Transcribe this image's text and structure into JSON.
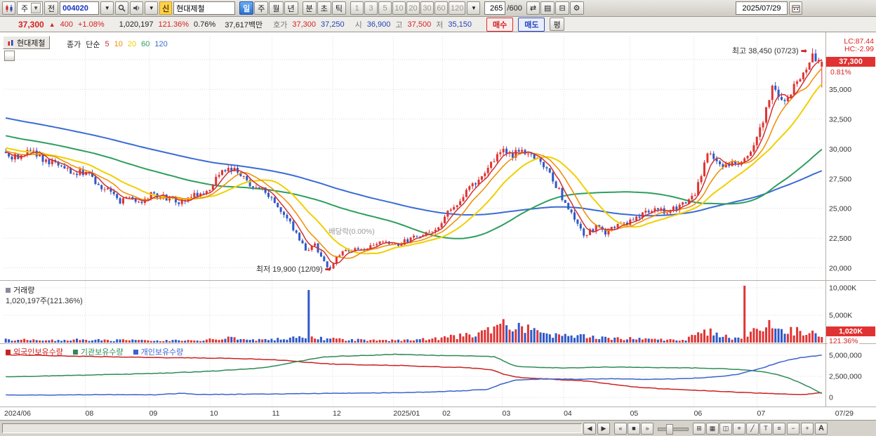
{
  "toolbar": {
    "period_select": "주",
    "prev_button": "전",
    "code_input": "004020",
    "new_badge": "신",
    "stock_name": "현대제철",
    "period_buttons": [
      "일",
      "주",
      "월",
      "년"
    ],
    "active_period": "일",
    "intraday_buttons": [
      "분",
      "초",
      "틱"
    ],
    "tick_presets": [
      "1",
      "3",
      "5",
      "10",
      "20",
      "30",
      "60",
      "120"
    ],
    "candle_count": "265",
    "candle_total": "/600",
    "date": "2025/07/29",
    "icon_glyphs": {
      "dropdown": "▼",
      "pan": "⇄",
      "layout": "▤",
      "save": "⊟",
      "gear": "⚙"
    }
  },
  "infobar": {
    "price": "37,300",
    "change_arrow": "▲",
    "change": "400",
    "change_pct": "+1.08%",
    "volume": "1,020,197",
    "volume_ratio": "121.36%",
    "strength": "0.76%",
    "value": "37,617백만",
    "hoga_label": "호가",
    "ask": "37,300",
    "bid": "37,250",
    "open_label": "시",
    "open": "36,900",
    "high_label": "고",
    "high": "37,500",
    "low_label": "저",
    "low": "35,150",
    "buy_button": "매수",
    "sell_button": "매도",
    "avg_button": "평"
  },
  "chart": {
    "tab_label": "현대제철",
    "legend_price_type": "종가",
    "legend_ma_type": "단순",
    "lc": "LC:87.44",
    "hc": "HC:-2.99",
    "price_tag": "37,300",
    "price_tag_pct": "0.81%",
    "annotation_high": "최고 38,450 (07/23)",
    "annotation_low": "최저 19,900 (12/09)",
    "annotation_exdiv": "배당락(0.00%)",
    "arrow_glyph": "➡",
    "volume_label": "거래량",
    "volume_value": "1,020,197주(121.36%)",
    "volume_tag": "1,020K",
    "volume_tag_pct": "121.36%"
  },
  "chart_data": {
    "type": "candlestick",
    "title": "현대제철(004020) 일봉 2024/06 ~ 2025/07/29",
    "visible_candles": 265,
    "colors": {
      "up": "#e03434",
      "down": "#3059c8"
    },
    "price_axis": {
      "ylim": [
        19500,
        39000
      ],
      "hidden_gridline": 37500,
      "ticks": [
        {
          "v": 35000,
          "label": "35,000"
        },
        {
          "v": 32500,
          "label": "32,500"
        },
        {
          "v": 30000,
          "label": "30,000"
        },
        {
          "v": 27500,
          "label": "27,500"
        },
        {
          "v": 25000,
          "label": "25,000"
        },
        {
          "v": 22500,
          "label": "22,500"
        },
        {
          "v": 20000,
          "label": "20,000"
        }
      ]
    },
    "x_labels": [
      {
        "label": "2024/06",
        "f": 0
      },
      {
        "label": "08",
        "f": 0.099
      },
      {
        "label": "09",
        "f": 0.177
      },
      {
        "label": "10",
        "f": 0.251
      },
      {
        "label": "11",
        "f": 0.327
      },
      {
        "label": "12",
        "f": 0.401
      },
      {
        "label": "2025/01",
        "f": 0.475
      },
      {
        "label": "02",
        "f": 0.535
      },
      {
        "label": "03",
        "f": 0.608
      },
      {
        "label": "04",
        "f": 0.683
      },
      {
        "label": "05",
        "f": 0.764
      },
      {
        "label": "06",
        "f": 0.842
      },
      {
        "label": "07",
        "f": 0.919
      }
    ],
    "x_last_label": "07/29",
    "close_keyframes": [
      [
        0,
        29600
      ],
      [
        0.012,
        29200
      ],
      [
        0.03,
        29750
      ],
      [
        0.048,
        29100
      ],
      [
        0.065,
        28600
      ],
      [
        0.08,
        28150
      ],
      [
        0.099,
        27900
      ],
      [
        0.11,
        27100
      ],
      [
        0.125,
        26400
      ],
      [
        0.14,
        25600
      ],
      [
        0.152,
        26000
      ],
      [
        0.165,
        25300
      ],
      [
        0.18,
        26300
      ],
      [
        0.195,
        25800
      ],
      [
        0.212,
        25600
      ],
      [
        0.228,
        26100
      ],
      [
        0.245,
        26500
      ],
      [
        0.258,
        27400
      ],
      [
        0.27,
        28300
      ],
      [
        0.285,
        28000
      ],
      [
        0.3,
        27100
      ],
      [
        0.315,
        26600
      ],
      [
        0.33,
        25500
      ],
      [
        0.345,
        24200
      ],
      [
        0.358,
        22700
      ],
      [
        0.368,
        21500
      ],
      [
        0.378,
        21900
      ],
      [
        0.388,
        20700
      ],
      [
        0.398,
        19950
      ],
      [
        0.408,
        21100
      ],
      [
        0.42,
        21600
      ],
      [
        0.435,
        21300
      ],
      [
        0.45,
        21800
      ],
      [
        0.465,
        22200
      ],
      [
        0.48,
        22000
      ],
      [
        0.495,
        22400
      ],
      [
        0.51,
        22800
      ],
      [
        0.525,
        23200
      ],
      [
        0.54,
        24400
      ],
      [
        0.555,
        25600
      ],
      [
        0.57,
        26700
      ],
      [
        0.585,
        27800
      ],
      [
        0.598,
        29200
      ],
      [
        0.61,
        30000
      ],
      [
        0.62,
        29500
      ],
      [
        0.632,
        30100
      ],
      [
        0.642,
        29400
      ],
      [
        0.655,
        28900
      ],
      [
        0.668,
        27600
      ],
      [
        0.68,
        26200
      ],
      [
        0.69,
        24800
      ],
      [
        0.7,
        23600
      ],
      [
        0.71,
        22800
      ],
      [
        0.722,
        23400
      ],
      [
        0.735,
        23000
      ],
      [
        0.75,
        23600
      ],
      [
        0.765,
        23900
      ],
      [
        0.78,
        24600
      ],
      [
        0.795,
        25000
      ],
      [
        0.81,
        24700
      ],
      [
        0.825,
        25200
      ],
      [
        0.838,
        25500
      ],
      [
        0.848,
        26800
      ],
      [
        0.856,
        28600
      ],
      [
        0.862,
        30100
      ],
      [
        0.87,
        29000
      ],
      [
        0.878,
        28200
      ],
      [
        0.888,
        28800
      ],
      [
        0.898,
        28500
      ],
      [
        0.908,
        29400
      ],
      [
        0.916,
        30300
      ],
      [
        0.925,
        31800
      ],
      [
        0.933,
        33400
      ],
      [
        0.94,
        35200
      ],
      [
        0.948,
        34200
      ],
      [
        0.956,
        33900
      ],
      [
        0.963,
        35000
      ],
      [
        0.97,
        35700
      ],
      [
        0.977,
        36400
      ],
      [
        0.984,
        37300
      ],
      [
        0.988,
        38000
      ],
      [
        0.993,
        37300
      ],
      [
        1,
        37300
      ]
    ],
    "pre_history": {
      "days": 120,
      "from": 35600,
      "to": 29700
    },
    "forced": {
      "low_f": 0.398,
      "low": 19900,
      "high_f": 0.988,
      "high": 38450,
      "last": {
        "open": 36900,
        "high": 37500,
        "low": 35150,
        "close": 37300
      }
    },
    "ma_periods": [
      5,
      10,
      20,
      60,
      120
    ],
    "ma_colors": {
      "5": "#cf3131",
      "10": "#f08c00",
      "20": "#f0d000",
      "60": "#2f9e5e",
      "120": "#3b6cd4"
    },
    "volume": {
      "axis_ticks": [
        {
          "v_k": 10000,
          "label": "10,000K"
        },
        {
          "v_k": 5000,
          "label": "5,000K"
        }
      ],
      "keyframes_k": [
        [
          0,
          650
        ],
        [
          0.05,
          480
        ],
        [
          0.1,
          520
        ],
        [
          0.15,
          420
        ],
        [
          0.2,
          380
        ],
        [
          0.25,
          520
        ],
        [
          0.27,
          800
        ],
        [
          0.3,
          550
        ],
        [
          0.33,
          700
        ],
        [
          0.36,
          900
        ],
        [
          0.39,
          750
        ],
        [
          0.42,
          520
        ],
        [
          0.46,
          420
        ],
        [
          0.5,
          560
        ],
        [
          0.53,
          800
        ],
        [
          0.56,
          1200
        ],
        [
          0.59,
          1900
        ],
        [
          0.61,
          3200
        ],
        [
          0.63,
          2600
        ],
        [
          0.65,
          2000
        ],
        [
          0.67,
          1400
        ],
        [
          0.69,
          1700
        ],
        [
          0.71,
          1200
        ],
        [
          0.74,
          700
        ],
        [
          0.77,
          750
        ],
        [
          0.8,
          600
        ],
        [
          0.83,
          520
        ],
        [
          0.85,
          1600
        ],
        [
          0.862,
          2400
        ],
        [
          0.875,
          1200
        ],
        [
          0.89,
          900
        ],
        [
          0.905,
          1400
        ],
        [
          0.92,
          2600
        ],
        [
          0.94,
          3000
        ],
        [
          0.955,
          2300
        ],
        [
          0.97,
          2000
        ],
        [
          0.985,
          1800
        ],
        [
          1,
          1100
        ]
      ],
      "spikes_k": [
        [
          0.373,
          9600,
          "down"
        ],
        [
          0.61,
          4300,
          "up"
        ],
        [
          0.627,
          3600,
          "down"
        ],
        [
          0.906,
          10400,
          "up"
        ]
      ],
      "last_k": 1020
    },
    "holdings": {
      "unit": "million_shares",
      "axis_ticks": [
        {
          "v": 5000000,
          "label": "5,000,000"
        },
        {
          "v": 2500000,
          "label": "2,500,000"
        },
        {
          "v": 0,
          "label": "0"
        }
      ],
      "series": [
        {
          "key": "foreign",
          "label": "외국인보유수량",
          "color": "#cc2222",
          "points_m": [
            [
              0,
              5.05
            ],
            [
              0.04,
              5
            ],
            [
              0.08,
              4.9
            ],
            [
              0.12,
              4.82
            ],
            [
              0.16,
              4.78
            ],
            [
              0.2,
              4.72
            ],
            [
              0.24,
              4.68
            ],
            [
              0.28,
              4.62
            ],
            [
              0.32,
              4.5
            ],
            [
              0.35,
              4.35
            ],
            [
              0.37,
              4.15
            ],
            [
              0.4,
              3.95
            ],
            [
              0.44,
              3.85
            ],
            [
              0.48,
              3.8
            ],
            [
              0.52,
              3.65
            ],
            [
              0.56,
              3.55
            ],
            [
              0.595,
              3.3
            ],
            [
              0.61,
              2.75
            ],
            [
              0.625,
              2.4
            ],
            [
              0.65,
              2.25
            ],
            [
              0.68,
              2.1
            ],
            [
              0.71,
              1.95
            ],
            [
              0.74,
              1.6
            ],
            [
              0.77,
              1.25
            ],
            [
              0.8,
              1.05
            ],
            [
              0.83,
              0.9
            ],
            [
              0.86,
              0.78
            ],
            [
              0.89,
              0.65
            ],
            [
              0.92,
              0.52
            ],
            [
              0.95,
              0.42
            ],
            [
              0.975,
              0.33
            ],
            [
              1,
              0.55
            ]
          ]
        },
        {
          "key": "institution",
          "label": "기관보유수량",
          "color": "#2e8b57",
          "points_m": [
            [
              0,
              2.45
            ],
            [
              0.05,
              2.55
            ],
            [
              0.1,
              2.65
            ],
            [
              0.15,
              2.75
            ],
            [
              0.2,
              2.9
            ],
            [
              0.25,
              3.1
            ],
            [
              0.3,
              3.4
            ],
            [
              0.33,
              3.7
            ],
            [
              0.36,
              4.3
            ],
            [
              0.385,
              4.75
            ],
            [
              0.41,
              4.9
            ],
            [
              0.45,
              5
            ],
            [
              0.475,
              5.12
            ],
            [
              0.5,
              5.05
            ],
            [
              0.54,
              4.95
            ],
            [
              0.58,
              4.9
            ],
            [
              0.6,
              4.82
            ],
            [
              0.612,
              4.2
            ],
            [
              0.625,
              3.7
            ],
            [
              0.65,
              3.55
            ],
            [
              0.69,
              3.5
            ],
            [
              0.73,
              3.6
            ],
            [
              0.77,
              3.58
            ],
            [
              0.81,
              3.52
            ],
            [
              0.85,
              3.48
            ],
            [
              0.88,
              3.4
            ],
            [
              0.91,
              3.25
            ],
            [
              0.93,
              3
            ],
            [
              0.95,
              2.6
            ],
            [
              0.97,
              1.9
            ],
            [
              0.985,
              1.2
            ],
            [
              1,
              0.45
            ]
          ]
        },
        {
          "key": "individual",
          "label": "개인보유수량",
          "color": "#3a63cc",
          "points_m": [
            [
              0,
              0.3
            ],
            [
              0.06,
              0.28
            ],
            [
              0.12,
              0.33
            ],
            [
              0.18,
              0.3
            ],
            [
              0.215,
              0.48
            ],
            [
              0.24,
              0.34
            ],
            [
              0.3,
              0.38
            ],
            [
              0.35,
              0.42
            ],
            [
              0.4,
              0.48
            ],
            [
              0.45,
              0.52
            ],
            [
              0.5,
              0.6
            ],
            [
              0.55,
              0.74
            ],
            [
              0.59,
              0.95
            ],
            [
              0.608,
              1.6
            ],
            [
              0.625,
              2.05
            ],
            [
              0.66,
              2.2
            ],
            [
              0.7,
              2.15
            ],
            [
              0.74,
              2.22
            ],
            [
              0.78,
              2.15
            ],
            [
              0.82,
              2.2
            ],
            [
              0.85,
              2.3
            ],
            [
              0.88,
              2.5
            ],
            [
              0.9,
              2.8
            ],
            [
              0.92,
              3.3
            ],
            [
              0.94,
              3.9
            ],
            [
              0.955,
              4.35
            ],
            [
              0.97,
              4.65
            ],
            [
              0.985,
              4.85
            ],
            [
              1,
              5
            ]
          ]
        }
      ]
    }
  },
  "bottom": {
    "nav_left": "◀",
    "nav_right": "▶",
    "nav_group": [
      "«",
      "■",
      "»"
    ],
    "icons": [
      {
        "name": "window-layout-icon",
        "glyph": "⊞"
      },
      {
        "name": "grid-icon",
        "glyph": "▦"
      },
      {
        "name": "compare-chart-icon",
        "glyph": "◫"
      },
      {
        "name": "crosshair-icon",
        "glyph": "⌖"
      },
      {
        "name": "trendline-icon",
        "glyph": "╱"
      },
      {
        "name": "text-tool-icon",
        "glyph": "T"
      },
      {
        "name": "indicator-list-icon",
        "glyph": "≡"
      }
    ],
    "zoom_out": "−",
    "zoom_in": "+",
    "font_button": "A"
  }
}
